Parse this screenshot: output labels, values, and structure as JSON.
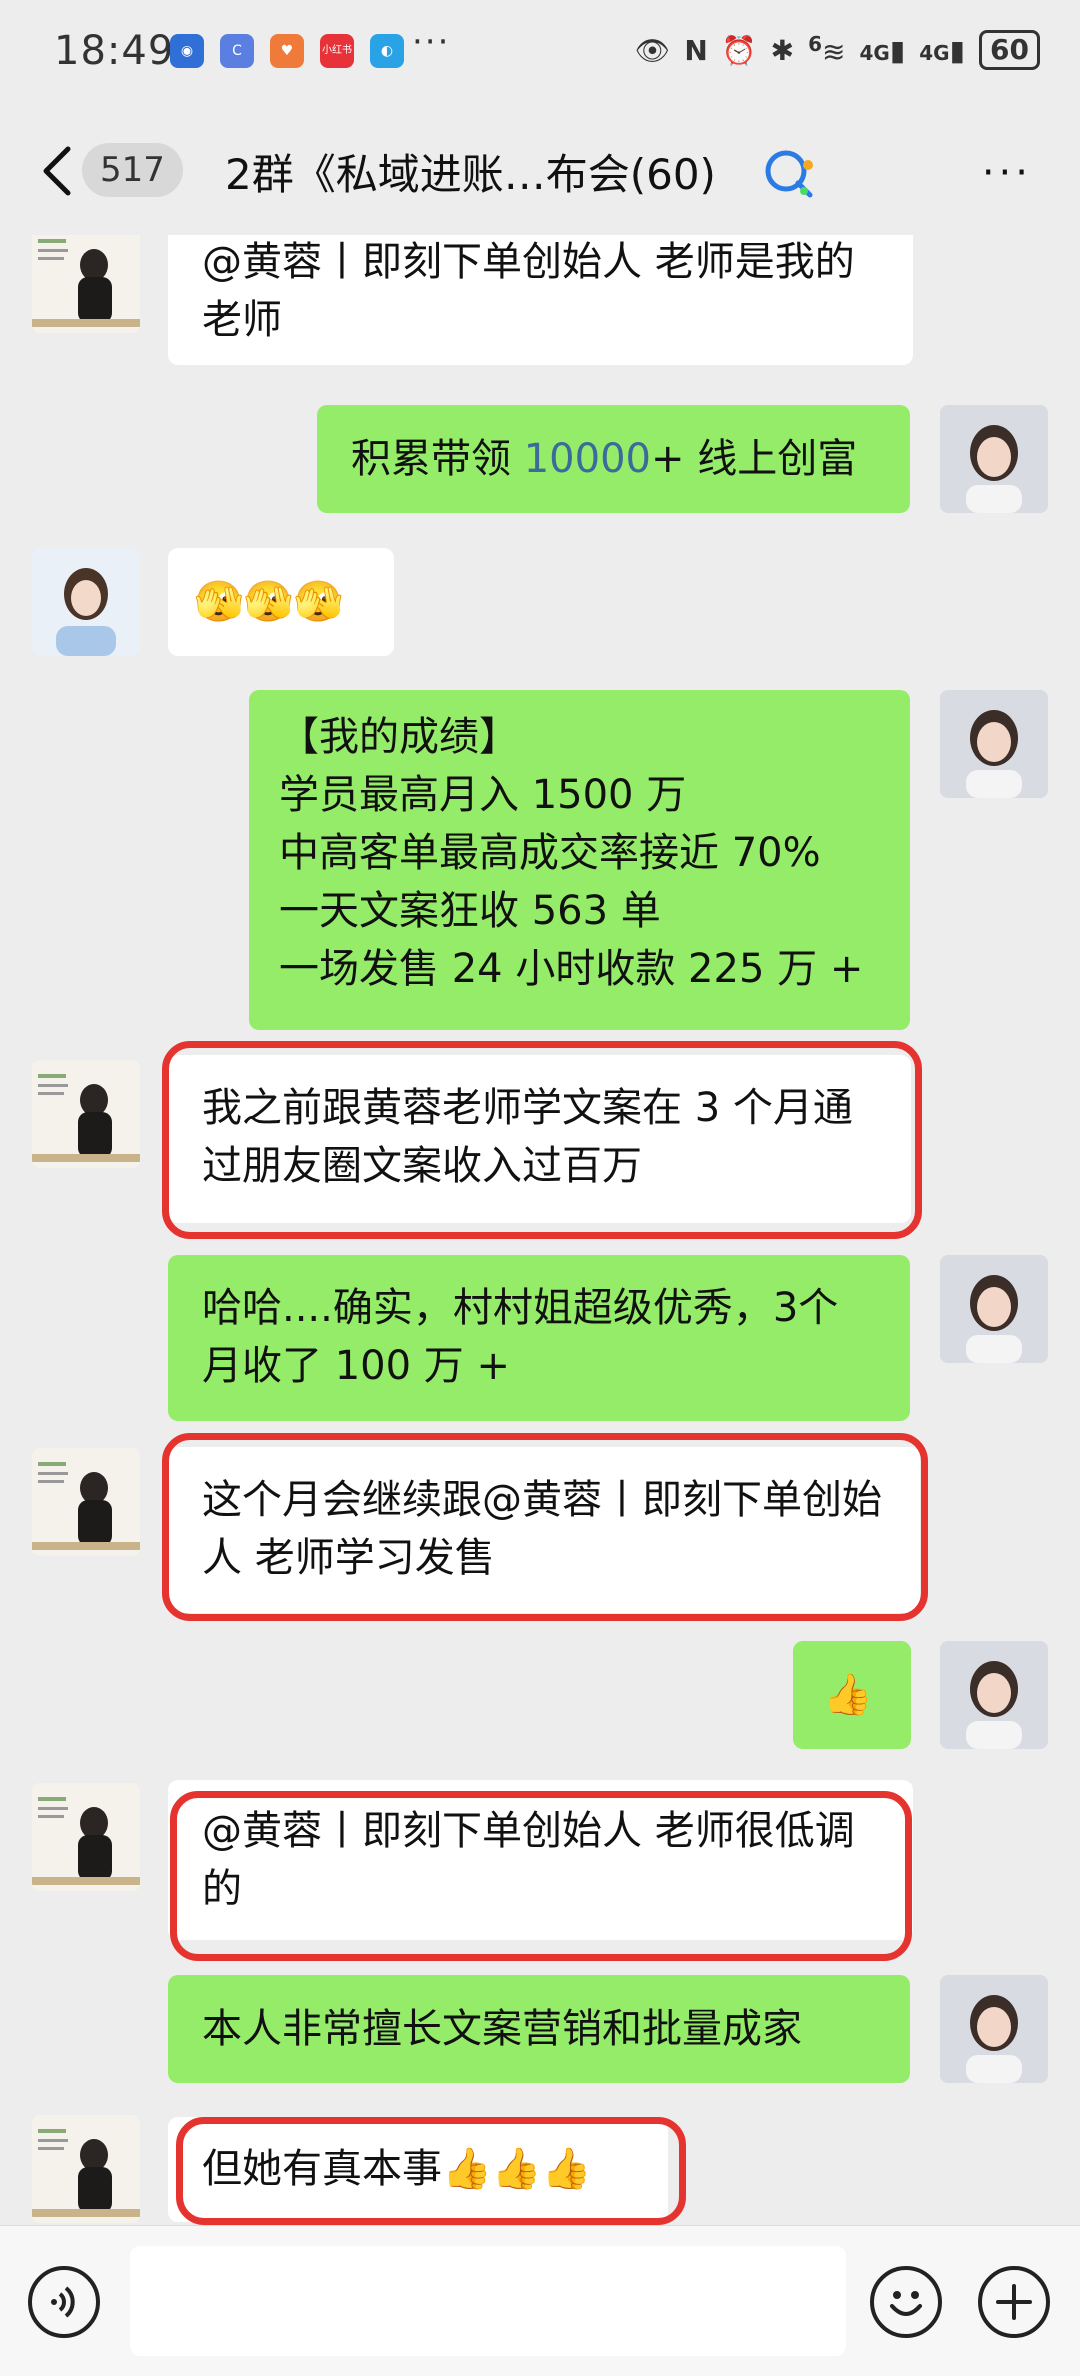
{
  "status_bar": {
    "time": "18:49",
    "app_icons": [
      "notification-icon",
      "c-app-icon",
      "heart-app-icon",
      "xiaohongshu-icon",
      "browser-icon"
    ],
    "xiaohongshu_label": "小红书",
    "overflow": "···",
    "network_1": "4G",
    "network_2": "4G",
    "wifi_badge": "6",
    "battery": "60"
  },
  "nav": {
    "unread_count": "517",
    "title": "2群《私域进账…布会(60)",
    "more": "···"
  },
  "messages": [
    {
      "side": "left",
      "text": "@黄蓉丨即刻下单创始人  老师是我的老师"
    },
    {
      "side": "right",
      "pre": "积累带领 ",
      "num": "10000",
      "post": "+ 线上创富"
    },
    {
      "side": "left",
      "emoji": "🫣🫣🫣"
    },
    {
      "side": "right",
      "lines": [
        "【我的成绩】",
        "学员最高月入 1500 万",
        "中高客单最高成交率接近 70%",
        "一天文案狂收 563 单",
        "一场发售 24 小时收款 225 万 +"
      ]
    },
    {
      "side": "left",
      "text": "我之前跟黄蓉老师学文案在 3 个月通过朋友圈文案收入过百万"
    },
    {
      "side": "right",
      "text": "哈哈....确实，村村姐超级优秀，3个月收了 100 万 +"
    },
    {
      "side": "left",
      "text": "这个月会继续跟@黄蓉丨即刻下单创始人  老师学习发售"
    },
    {
      "side": "right",
      "emoji": "👍"
    },
    {
      "side": "left",
      "text": "@黄蓉丨即刻下单创始人  老师很低调的"
    },
    {
      "side": "right",
      "text": "本人非常擅长文案营销和批量成家"
    },
    {
      "side": "left",
      "text": "但她有真本事",
      "emoji": "👍👍👍"
    }
  ],
  "colors": {
    "bubble_green": "#95ec69",
    "bubble_white": "#ffffff",
    "highlight_red": "#e5342f",
    "background": "#ededed"
  }
}
